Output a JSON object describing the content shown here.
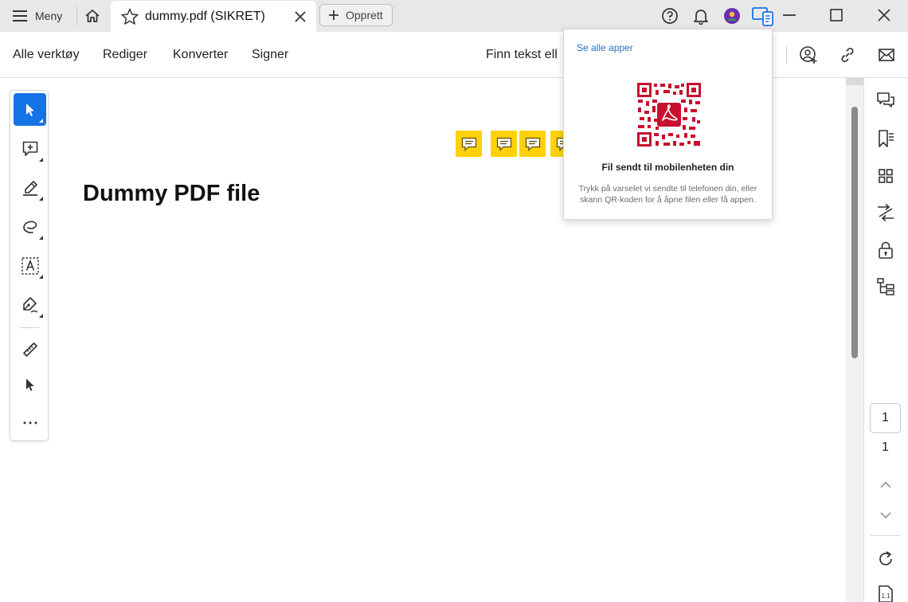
{
  "titlebar": {
    "menu_label": "Meny",
    "tab_label": "dummy.pdf (SIKRET)",
    "create_label": "Opprett"
  },
  "toolbar": {
    "menus": [
      "Alle verktøy",
      "Rediger",
      "Konverter",
      "Signer"
    ],
    "find_text": "Finn tekst ell"
  },
  "left_tools": [
    {
      "icon": "select-arrow-icon",
      "active": true
    },
    {
      "icon": "add-comment-icon"
    },
    {
      "icon": "highlight-pen-icon"
    },
    {
      "icon": "freehand-draw-icon"
    },
    {
      "icon": "text-box-icon"
    },
    {
      "icon": "sign-pen-icon"
    },
    {
      "icon": "measure-ruler-icon"
    },
    {
      "icon": "pointer-icon"
    },
    {
      "icon": "more-icon"
    }
  ],
  "document": {
    "title": "Dummy PDF file",
    "comment_notes": 4
  },
  "page_nav": {
    "current_page": "1",
    "total_pages": "1"
  },
  "popup": {
    "see_all_apps": "Se alle apper",
    "sent_title": "Fil sendt til mobilenheten din",
    "sent_desc": "Trykk på varselet vi sendte til telefonen din, eller skann QR-koden for å åpne filen eller få appen."
  },
  "colors": {
    "accent": "#1473e6",
    "comment_note": "#ffd10a",
    "qr_red": "#c8102e",
    "titlebar_bg": "#e8e8e8"
  }
}
